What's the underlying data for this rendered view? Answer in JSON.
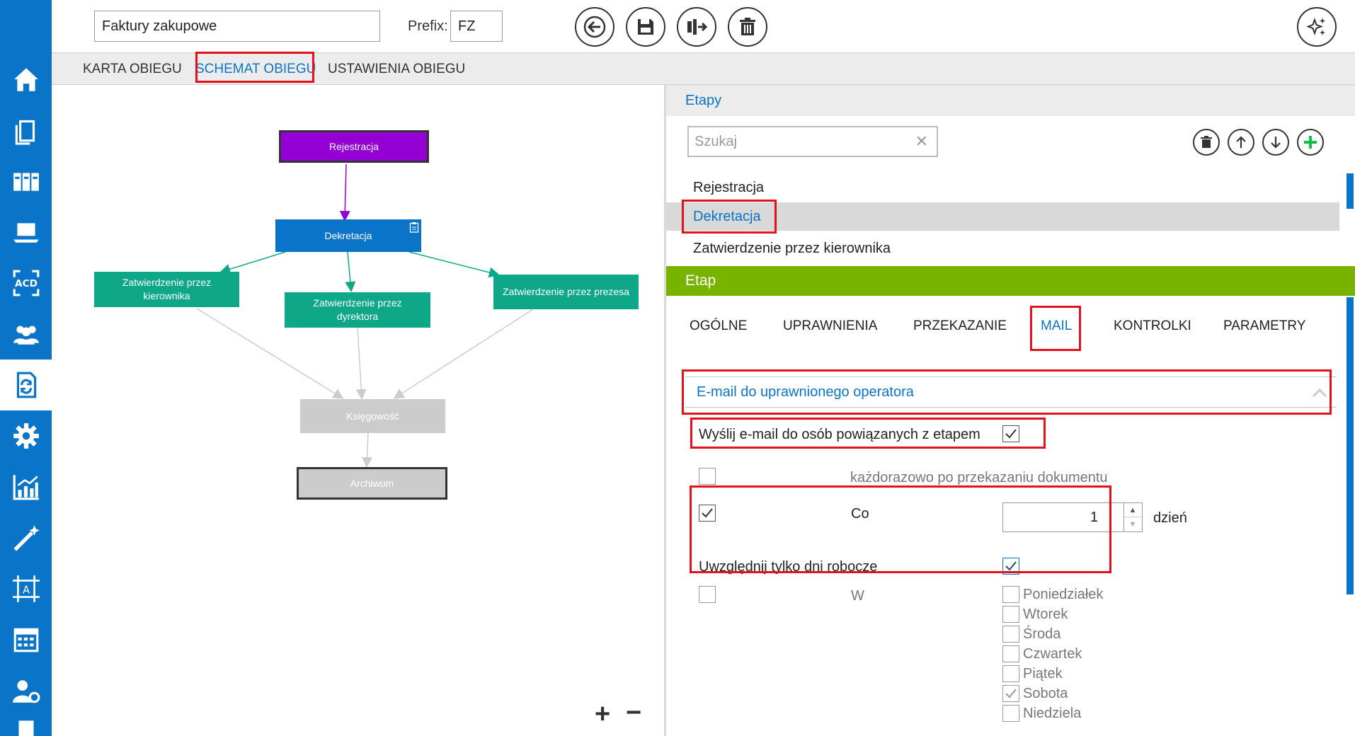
{
  "header": {
    "workflow_name": "Faktury zakupowe",
    "prefix_label": "Prefix:",
    "prefix_value": "FZ"
  },
  "tabs": [
    {
      "label": "KARTA OBIEGU"
    },
    {
      "label": "SCHEMAT OBIEGU"
    },
    {
      "label": "USTAWIENIA OBIEGU"
    }
  ],
  "diagram": {
    "nodes": [
      {
        "label": "Rejestracja"
      },
      {
        "label": "Dekretacja"
      },
      {
        "label": "Zatwierdzenie przez kierownika"
      },
      {
        "label": "Zatwierdzenie przez dyrektora"
      },
      {
        "label": "Zatwierdzenie przez prezesa"
      },
      {
        "label": "Księgowość"
      },
      {
        "label": "Archiwum"
      }
    ],
    "zoom_in": "+",
    "zoom_out": "−"
  },
  "stages": {
    "title": "Etapy",
    "search_placeholder": "Szukaj",
    "items": [
      "Rejestracja",
      "Dekretacja",
      "Zatwierdzenie przez kierownika"
    ]
  },
  "stage": {
    "title": "Etap",
    "subtabs": [
      "OGÓLNE",
      "UPRAWNIENIA",
      "PRZEKAZANIE",
      "MAIL",
      "KONTROLKI",
      "PARAMETRY"
    ],
    "accordion_title": "E-mail do uprawnionego operatora",
    "send_email_label": "Wyślij e-mail do osób powiązanych z etapem",
    "each_time_label": "każdorazowo po przekazaniu dokumentu",
    "every_label": "Co",
    "every_value": "1",
    "every_unit": "dzień",
    "workdays_label": "Uwzględnij tylko dni robocze",
    "on_label": "W",
    "days": [
      "Poniedziałek",
      "Wtorek",
      "Środa",
      "Czwartek",
      "Piątek",
      "Sobota",
      "Niedziela"
    ]
  },
  "colors": {
    "accent": "#0a74c9",
    "rejestracja": "#9400d3",
    "dekretacja": "#0a74c9",
    "approval": "#0ea889",
    "inactive": "#cccccc",
    "etap_header": "#78b300",
    "highlight": "#e3111b"
  }
}
